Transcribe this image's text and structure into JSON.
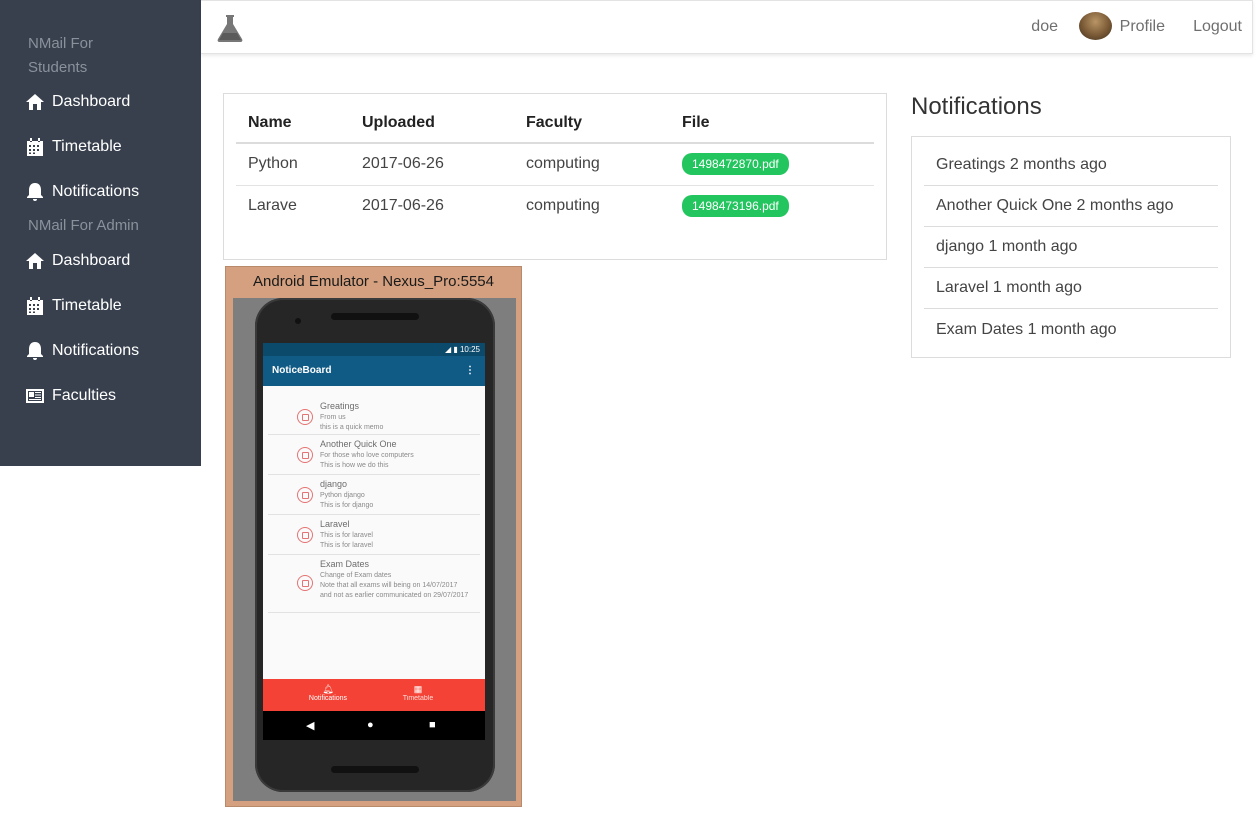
{
  "sidebar": {
    "student_section": "NMail For Students",
    "student_items": [
      {
        "label": "Dashboard",
        "icon": "home-icon"
      },
      {
        "label": "Timetable",
        "icon": "calendar-icon"
      },
      {
        "label": "Notifications",
        "icon": "bell-icon"
      }
    ],
    "admin_section": "NMail For Admin",
    "admin_items": [
      {
        "label": "Dashboard",
        "icon": "home-icon"
      },
      {
        "label": "Timetable",
        "icon": "calendar-icon"
      },
      {
        "label": "Notifications",
        "icon": "bell-icon"
      },
      {
        "label": "Faculties",
        "icon": "newspaper-icon"
      }
    ]
  },
  "topbar": {
    "user": "doe",
    "profile": "Profile",
    "logout": "Logout"
  },
  "uploads": {
    "headers": [
      "Name",
      "Uploaded",
      "Faculty",
      "File"
    ],
    "rows": [
      {
        "name": "Python",
        "uploaded": "2017-06-26",
        "faculty": "computing",
        "file": "1498472870.pdf"
      },
      {
        "name": "Larave",
        "uploaded": "2017-06-26",
        "faculty": "computing",
        "file": "1498473196.pdf"
      }
    ]
  },
  "notifications": {
    "title": "Notifications",
    "items": [
      "Greatings 2 months ago",
      "Another Quick One 2 months ago",
      "django 1 month ago",
      "Laravel 1 month ago",
      "Exam Dates 1 month ago"
    ]
  },
  "emulator": {
    "title": "Android Emulator - Nexus_Pro:5554",
    "time": "10:25",
    "app_title": "NoticeBoard",
    "notices": [
      {
        "title": "Greatings",
        "lines": [
          "From us",
          "this is a quick memo"
        ]
      },
      {
        "title": "Another Quick One",
        "lines": [
          "For those who love computers",
          "This is how we do this"
        ]
      },
      {
        "title": "django",
        "lines": [
          "Python django",
          "This is for django"
        ]
      },
      {
        "title": "Laravel",
        "lines": [
          "This is for laravel",
          "This is for laravel"
        ]
      },
      {
        "title": "Exam Dates",
        "lines": [
          "Change of Exam dates",
          "Note that all exams will being on 14/07/2017 and not as earlier communicated on 29/07/2017"
        ]
      }
    ],
    "bottom_nav": [
      "Notifications",
      "Timetable"
    ]
  },
  "colors": {
    "sidebar": "#38404e",
    "pill": "#22c55e",
    "appbar": "#105b86",
    "bottom_nav": "#f44336"
  }
}
